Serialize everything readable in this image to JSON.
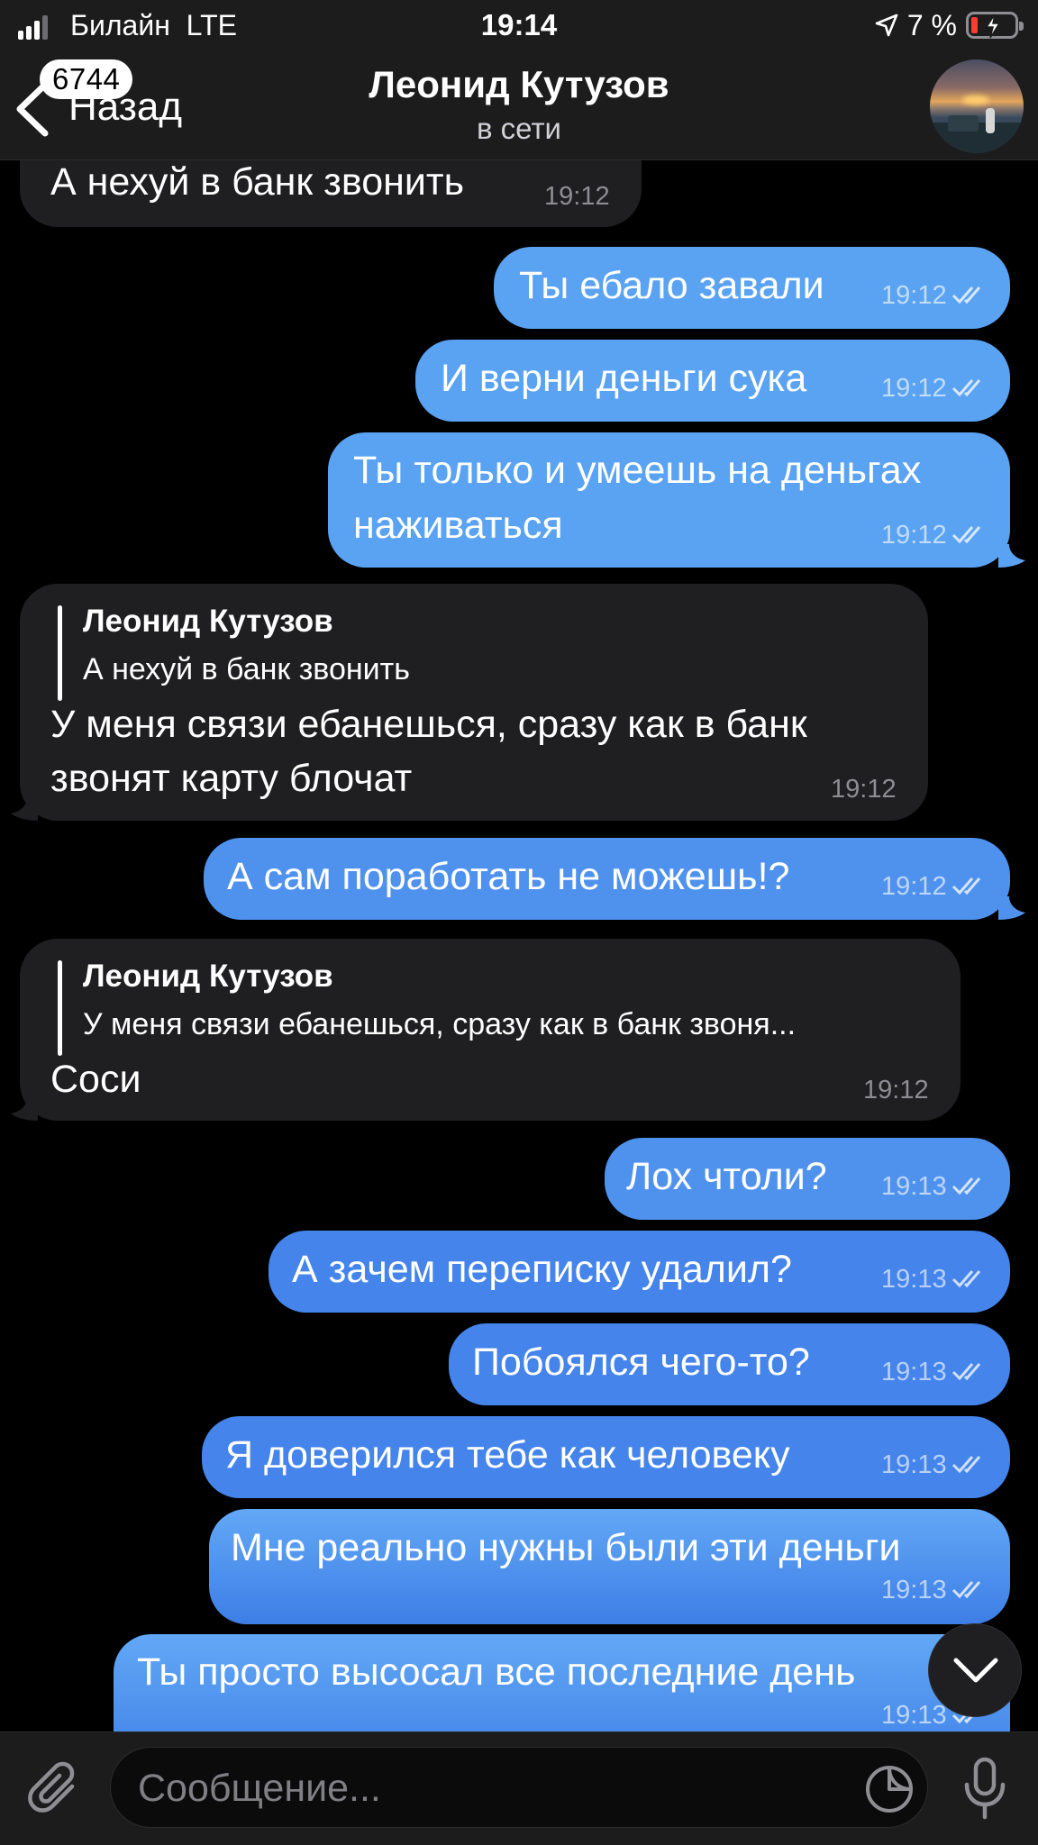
{
  "status_bar": {
    "carrier": "Билайн",
    "network": "LTE",
    "time": "19:14",
    "battery_percent": "7 %"
  },
  "header": {
    "back_label": "Назад",
    "unread_badge": "6744",
    "chat_title": "Леонид Кутузов",
    "chat_status": "в сети",
    "avatar_icon": "profile-photo"
  },
  "messages": [
    {
      "direction": "in",
      "text": "А нехуй в банк звонить",
      "time": "19:12"
    },
    {
      "direction": "out",
      "text": "Ты ебало завали",
      "time": "19:12",
      "read": true
    },
    {
      "direction": "out",
      "text": "И верни деньги сука",
      "time": "19:12",
      "read": true
    },
    {
      "direction": "out",
      "text_lines": [
        "Ты только и умеешь на деньгах",
        "наживаться"
      ],
      "time": "19:12",
      "read": true
    },
    {
      "direction": "in",
      "reply": {
        "name": "Леонид Кутузов",
        "text": "А нехуй в банк звонить"
      },
      "text_lines": [
        "У меня связи ебанешься, сразу как в банк",
        "звонят карту блочат"
      ],
      "time": "19:12"
    },
    {
      "direction": "out",
      "text": "А сам поработать не можешь!?",
      "time": "19:12",
      "read": true
    },
    {
      "direction": "in",
      "reply": {
        "name": "Леонид Кутузов",
        "text": "У меня связи ебанешься, сразу как в банк звоня..."
      },
      "text": "Соси",
      "time": "19:12"
    },
    {
      "direction": "out",
      "text": "Лох чтоли?",
      "time": "19:13",
      "read": true
    },
    {
      "direction": "out",
      "text": "А зачем переписку удалил?",
      "time": "19:13",
      "read": true
    },
    {
      "direction": "out",
      "text": "Побоялся чего-то?",
      "time": "19:13",
      "read": true
    },
    {
      "direction": "out",
      "text": "Я доверился тебе как человеку",
      "time": "19:13",
      "read": true
    },
    {
      "direction": "out",
      "text": "Мне реально нужны были эти деньги",
      "time": "19:13",
      "read": true
    },
    {
      "direction": "out",
      "text": "Ты просто высосал все последние день",
      "time": "19:13",
      "read": true
    }
  ],
  "input": {
    "placeholder": "Сообщение..."
  },
  "colors": {
    "background": "#000000",
    "incoming_bubble": "#1f1f21",
    "outgoing_bubble_top": "#62a8f6",
    "outgoing_bubble_bottom": "#3d7ee6",
    "bars": "#1c1c1d"
  }
}
